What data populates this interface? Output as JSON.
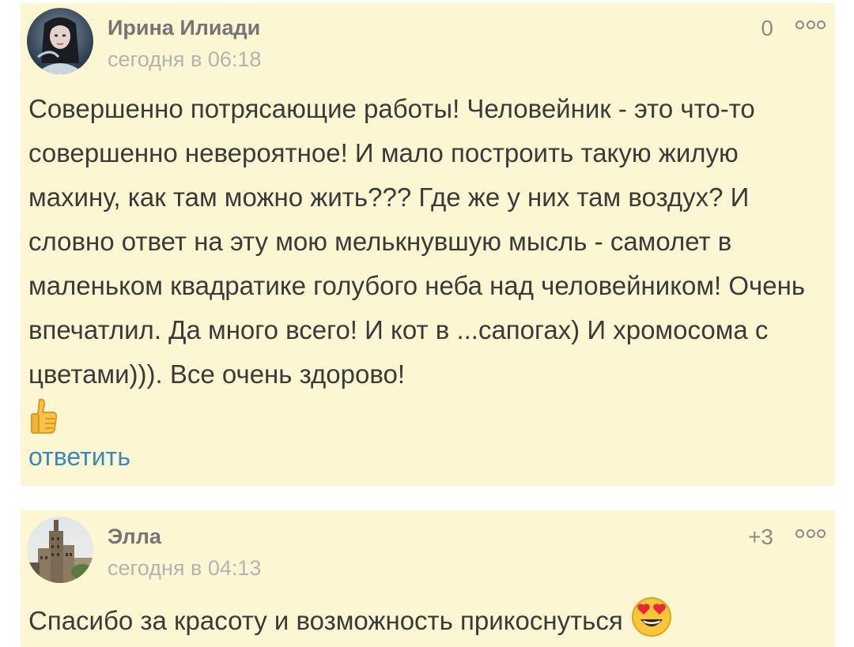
{
  "comments": [
    {
      "author": "Ирина Илиади",
      "time": "сегодня в 06:18",
      "rating": "0",
      "text": "Совершенно потрясающие работы! Человейник - это что-то совершенно невероятное! И мало построить такую жилую махину, как там можно жить??? Где же у них там воздух? И словно ответ на эту мою мелькнувшую мысль - самолет в маленьком квадратике голубого неба над человейником! Очень впечатлил. Да много всего! И кот в ...сапогах) И хромосома с цветами))). Все очень здорово!",
      "emoji_icon": "thumbs-up-icon",
      "reply_label": "ответить"
    },
    {
      "author": "Элла",
      "time": "сегодня в 04:13",
      "rating": "+3",
      "text": "Спасибо за красоту и возможность прикоснуться",
      "emoji_icon": "heart-eyes-icon"
    }
  ],
  "colors": {
    "card_background": "#fdf6d3",
    "link": "#3b88b8",
    "text": "#3a3a3a",
    "author": "#757575",
    "time": "#b3b3b3"
  }
}
